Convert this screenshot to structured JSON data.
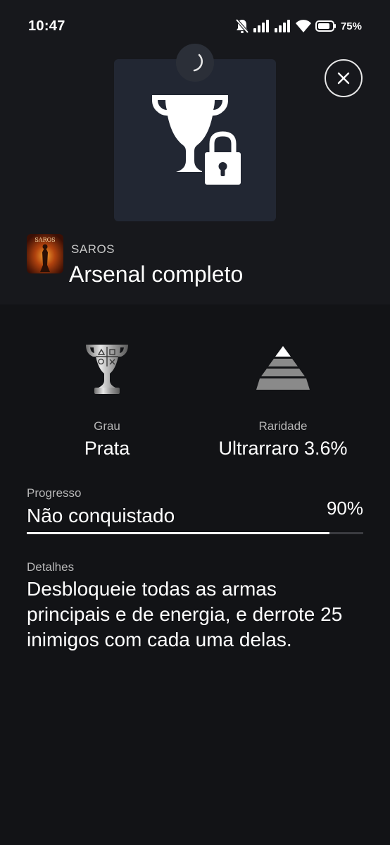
{
  "status_bar": {
    "time": "10:47",
    "battery": "75%",
    "icons": [
      "mute-icon",
      "signal-icon",
      "signal-icon",
      "wifi-icon",
      "battery-icon"
    ]
  },
  "trophy": {
    "icon": "locked-trophy-icon",
    "game": "SAROS",
    "game_art_label": "SAROS",
    "title": "Arsenal completo"
  },
  "stats": {
    "grade_label": "Grau",
    "grade_value": "Prata",
    "grade_icon": "silver-trophy-icon",
    "rarity_label": "Raridade",
    "rarity_value": "Ultrarraro 3.6%",
    "rarity_icon": "rarity-pyramid-icon"
  },
  "progress": {
    "label": "Progresso",
    "status": "Não conquistado",
    "percent_text": "90%",
    "value": 0.9
  },
  "details": {
    "label": "Detalhes",
    "text": "Desbloqueie todas as armas principais e de energia, e derrote 25 inimigos com cada uma delas."
  },
  "colors": {
    "background": "#121316",
    "header_background": "#17181c",
    "card": "#222733",
    "text": "#ffffff",
    "muted": "#b6b6b6"
  }
}
